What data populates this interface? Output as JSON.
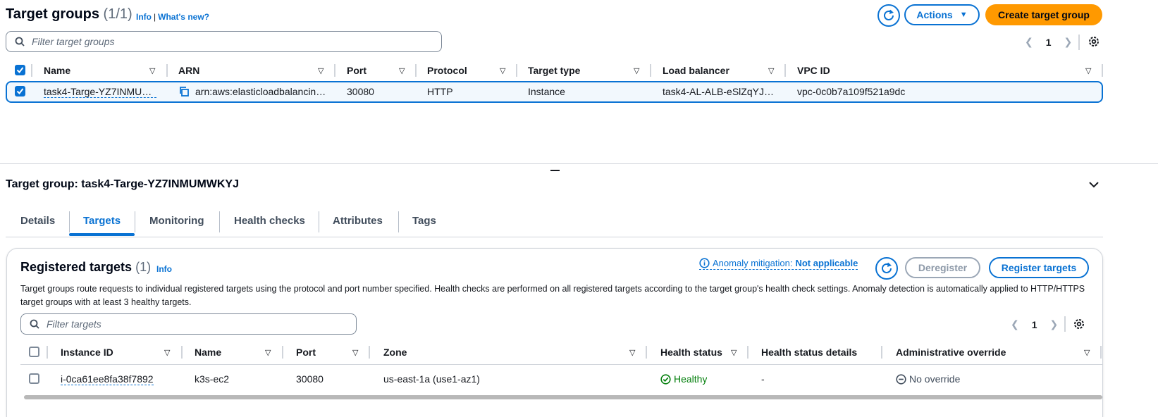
{
  "header": {
    "title": "Target groups",
    "count": "(1/1)",
    "info_link": "Info",
    "whats_new_link": "What's new?",
    "actions_label": "Actions",
    "create_label": "Create target group"
  },
  "search": {
    "placeholder": "Filter target groups"
  },
  "pager": {
    "page": "1"
  },
  "table": {
    "columns": [
      "Name",
      "ARN",
      "Port",
      "Protocol",
      "Target type",
      "Load balancer",
      "VPC ID"
    ],
    "rows": [
      {
        "name": "task4-Targe-YZ7INMUM…",
        "arn": "arn:aws:elasticloadbalancin…",
        "port": "30080",
        "protocol": "HTTP",
        "target_type": "Instance",
        "load_balancer": "task4-AL-ALB-eSlZqYJ7…",
        "vpc_id": "vpc-0c0b7a109f521a9dc"
      }
    ]
  },
  "detail": {
    "title": "Target group: task4-Targe-YZ7INMUMWKYJ",
    "tabs": [
      "Details",
      "Targets",
      "Monitoring",
      "Health checks",
      "Attributes",
      "Tags"
    ],
    "active_tab": "Targets"
  },
  "registered": {
    "title": "Registered targets",
    "count": "(1)",
    "info_link": "Info",
    "anomaly_label": "Anomaly mitigation:",
    "anomaly_value": "Not applicable",
    "deregister_label": "Deregister",
    "register_label": "Register targets",
    "description": "Target groups route requests to individual registered targets using the protocol and port number specified. Health checks are performed on all registered targets according to the target group's health check settings. Anomaly detection is automatically applied to HTTP/HTTPS target groups with at least 3 healthy targets.",
    "search_placeholder": "Filter targets",
    "page": "1",
    "columns": [
      "Instance ID",
      "Name",
      "Port",
      "Zone",
      "Health status",
      "Health status details",
      "Administrative override"
    ],
    "rows": [
      {
        "instance_id": "i-0ca61ee8fa38f7892",
        "name": "k3s-ec2",
        "port": "30080",
        "zone": "us-east-1a (use1-az1)",
        "health_status": "Healthy",
        "health_details": "-",
        "admin_override": "No override"
      }
    ]
  },
  "colors": {
    "primary": "#0972d3",
    "orange": "#ff9900",
    "healthy": "#037f0c"
  }
}
